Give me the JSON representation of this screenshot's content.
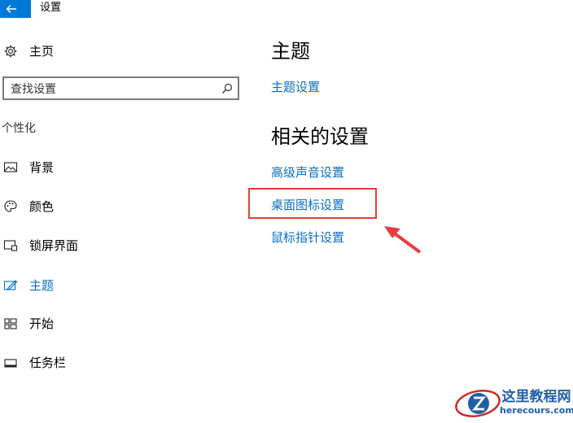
{
  "window": {
    "title": "设置"
  },
  "nav": {
    "home_label": "主页",
    "search_placeholder": "查找设置",
    "section_label": "个性化",
    "items": [
      {
        "label": "背景"
      },
      {
        "label": "颜色"
      },
      {
        "label": "锁屏界面"
      },
      {
        "label": "主题"
      },
      {
        "label": "开始"
      },
      {
        "label": "任务栏"
      }
    ],
    "selected": "主题"
  },
  "main": {
    "heading": "主题",
    "theme_settings_link": "主题设置",
    "related_heading": "相关的设置",
    "related_links": [
      {
        "label": "高级声音设置"
      },
      {
        "label": "桌面图标设置"
      },
      {
        "label": "鼠标指针设置"
      }
    ],
    "highlighted_link": "桌面图标设置"
  },
  "watermark": {
    "site_name": "这里教程网",
    "url": "herecours.com"
  },
  "colors": {
    "accent": "#0078d7",
    "link": "#0a6fc2",
    "annotation": "#e83c3c"
  },
  "icons": {
    "back": "arrow-left-icon",
    "home": "gear-icon",
    "search": "search-icon",
    "background": "picture-icon",
    "colors": "palette-icon",
    "lockscreen": "monitor-icon",
    "themes": "brush-icon",
    "start": "start-grid-icon",
    "taskbar": "taskbar-icon"
  }
}
